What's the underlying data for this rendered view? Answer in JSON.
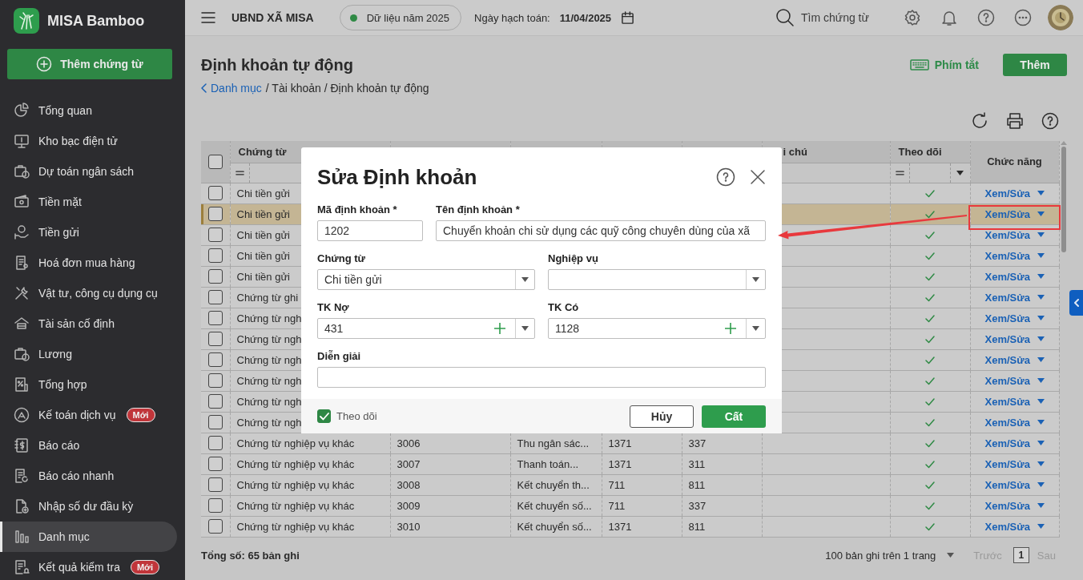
{
  "app": {
    "name": "MISA Bamboo",
    "add_button": "Thêm chứng từ"
  },
  "sidebar": {
    "items": [
      {
        "label": "Tổng quan",
        "selected": false
      },
      {
        "label": "Kho bạc điện tử",
        "selected": false
      },
      {
        "label": "Dự toán ngân sách",
        "selected": false
      },
      {
        "label": "Tiền mặt",
        "selected": false
      },
      {
        "label": "Tiền gửi",
        "selected": false
      },
      {
        "label": "Hoá đơn mua hàng",
        "selected": false
      },
      {
        "label": "Vật tư, công cụ dụng cụ",
        "selected": false
      },
      {
        "label": "Tài sản cố định",
        "selected": false
      },
      {
        "label": "Lương",
        "selected": false
      },
      {
        "label": "Tổng hợp",
        "selected": false
      },
      {
        "label": "Kế toán dịch vụ",
        "selected": false,
        "badge": "Mới"
      },
      {
        "label": "Báo cáo",
        "selected": false
      },
      {
        "label": "Báo cáo nhanh",
        "selected": false
      },
      {
        "label": "Nhập số dư đầu kỳ",
        "selected": false
      },
      {
        "label": "Danh mục",
        "selected": true
      },
      {
        "label": "Kết quả kiểm tra",
        "selected": false,
        "badge": "Mới"
      }
    ]
  },
  "header": {
    "org": "UBND XÃ MISA",
    "data_year": "Dữ liệu năm 2025",
    "date_label": "Ngày hạch toán:",
    "date": "11/04/2025",
    "search": {
      "placeholder": "Tìm chứng từ"
    }
  },
  "page": {
    "title": "Định khoản tự động",
    "back_link": "Danh mục",
    "trail": "/ Tài khoản / Định khoản tự động",
    "shortcut_button": "Phím tắt",
    "add_button": "Thêm"
  },
  "table": {
    "select_all_checked": false,
    "columns": [
      {
        "kind": "text",
        "label": "Chứng từ",
        "filter": true
      },
      {
        "kind": "text"
      },
      {
        "kind": "text"
      },
      {
        "kind": "text"
      },
      {
        "kind": "text"
      },
      {
        "kind": "text",
        "label": "i chú",
        "filter": false
      },
      {
        "kind": "check",
        "label": "Theo dõi",
        "filter": true
      },
      {
        "kind": "action",
        "label": "Chức năng"
      }
    ],
    "rows": [
      {
        "selected": false,
        "highlighted": false,
        "cells": [
          "Chi tiền gửi"
        ],
        "followed": true,
        "action": "Xem/Sửa"
      },
      {
        "selected": false,
        "highlighted": true,
        "cells": [
          "Chi tiền gửi"
        ],
        "followed": true,
        "action": "Xem/Sửa"
      },
      {
        "selected": false,
        "highlighted": false,
        "cells": [
          "Chi tiền gửi"
        ],
        "followed": true,
        "action": "Xem/Sửa"
      },
      {
        "selected": false,
        "highlighted": false,
        "cells": [
          "Chi tiền gửi"
        ],
        "followed": true,
        "action": "Xem/Sửa"
      },
      {
        "selected": false,
        "highlighted": false,
        "cells": [
          "Chi tiền gửi"
        ],
        "followed": true,
        "action": "Xem/Sửa"
      },
      {
        "selected": false,
        "highlighted": false,
        "cells": [
          "Chứng từ ghi"
        ],
        "followed": true,
        "action": "Xem/Sửa"
      },
      {
        "selected": false,
        "highlighted": false,
        "cells": [
          "Chứng từ ngh"
        ],
        "followed": true,
        "action": "Xem/Sửa"
      },
      {
        "selected": false,
        "highlighted": false,
        "cells": [
          "Chứng từ ngh"
        ],
        "followed": true,
        "action": "Xem/Sửa"
      },
      {
        "selected": false,
        "highlighted": false,
        "cells": [
          "Chứng từ ngh"
        ],
        "followed": true,
        "action": "Xem/Sửa"
      },
      {
        "selected": false,
        "highlighted": false,
        "cells": [
          "Chứng từ ngh"
        ],
        "followed": true,
        "action": "Xem/Sửa"
      },
      {
        "selected": false,
        "highlighted": false,
        "cells": [
          "Chứng từ ngh"
        ],
        "followed": true,
        "action": "Xem/Sửa"
      },
      {
        "selected": false,
        "highlighted": false,
        "cells": [
          "Chứng từ ngh"
        ],
        "followed": true,
        "action": "Xem/Sửa"
      },
      {
        "selected": false,
        "highlighted": false,
        "cells": [
          "Chứng từ nghiệp vụ khác",
          "3006",
          "Thu ngân sác...",
          "1371",
          "337"
        ],
        "followed": true,
        "action": "Xem/Sửa"
      },
      {
        "selected": false,
        "highlighted": false,
        "cells": [
          "Chứng từ nghiệp vụ khác",
          "3007",
          "Thanh toán...",
          "1371",
          "311"
        ],
        "followed": true,
        "action": "Xem/Sửa"
      },
      {
        "selected": false,
        "highlighted": false,
        "cells": [
          "Chứng từ nghiệp vụ khác",
          "3008",
          "Kết chuyển th...",
          "711",
          "811"
        ],
        "followed": true,
        "action": "Xem/Sửa"
      },
      {
        "selected": false,
        "highlighted": false,
        "cells": [
          "Chứng từ nghiệp vụ khác",
          "3009",
          "Kết chuyển số...",
          "711",
          "337"
        ],
        "followed": true,
        "action": "Xem/Sửa"
      },
      {
        "selected": false,
        "highlighted": false,
        "cells": [
          "Chứng từ nghiệp vụ khác",
          "3010",
          "Kết chuyển số...",
          "1371",
          "811"
        ],
        "followed": true,
        "action": "Xem/Sửa"
      }
    ],
    "footer": {
      "total": "Tổng số: 65 bản ghi",
      "page_size": "100 bản ghi trên 1 trang",
      "prev": "Trước",
      "page": "1",
      "next": "Sau"
    }
  },
  "dialog": {
    "title": "Sửa Định khoản",
    "rows": [
      [
        {
          "kind": "text",
          "label": "Mã định khoản *",
          "value": "1202"
        },
        {
          "kind": "text",
          "label": "Tên định khoản *",
          "value": "Chuyển khoản chi sử dụng các quỹ công chuyên dùng của xã"
        }
      ],
      [
        {
          "kind": "select",
          "label": "Chứng từ",
          "value": "Chi tiền gửi"
        },
        {
          "kind": "select",
          "label": "Nghiệp vụ"
        }
      ],
      [
        {
          "kind": "account",
          "label": "TK Nợ",
          "value": "431"
        },
        {
          "kind": "account",
          "label": "TK Có",
          "value": "1128"
        }
      ],
      [
        {
          "kind": "text",
          "label": "Diễn giải"
        }
      ]
    ],
    "follow": {
      "label": "Theo dõi",
      "checked": true
    },
    "buttons": [
      {
        "kind": "secondary",
        "label": "Hủy"
      },
      {
        "kind": "primary",
        "label": "Cất"
      }
    ]
  }
}
